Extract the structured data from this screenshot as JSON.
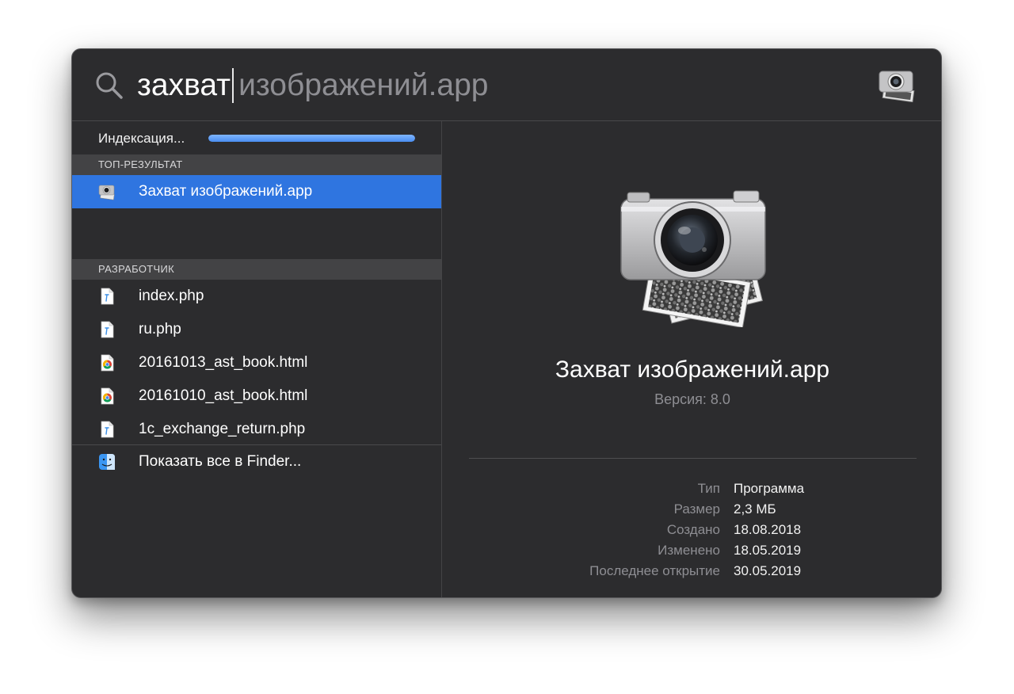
{
  "search": {
    "typed": "захват",
    "completion": "изображений.app"
  },
  "indexing": {
    "label": "Индексация...",
    "progress": 1.0
  },
  "sections": {
    "top_result": "ТОП-РЕЗУЛЬТАТ",
    "developer": "РАЗРАБОТЧИК"
  },
  "top_result": {
    "label": "Захват изображений.app",
    "icon": "image-capture-icon"
  },
  "developer_items": [
    {
      "label": "index.php",
      "icon": "php-file-icon"
    },
    {
      "label": "ru.php",
      "icon": "php-file-icon"
    },
    {
      "label": "20161013_ast_book.html",
      "icon": "chrome-html-icon"
    },
    {
      "label": "20161010_ast_book.html",
      "icon": "chrome-html-icon"
    },
    {
      "label": "1c_exchange_return.php",
      "icon": "php-file-icon"
    }
  ],
  "show_all": {
    "label": "Показать все в Finder...",
    "icon": "finder-icon"
  },
  "preview": {
    "name": "Захват изображений.app",
    "version": "Версия: 8.0",
    "meta": [
      {
        "key": "Тип",
        "value": "Программа"
      },
      {
        "key": "Размер",
        "value": "2,3 МБ"
      },
      {
        "key": "Создано",
        "value": "18.08.2018"
      },
      {
        "key": "Изменено",
        "value": "18.05.2019"
      },
      {
        "key": "Последнее открытие",
        "value": "30.05.2019"
      }
    ]
  },
  "colors": {
    "window_bg": "#2c2c2e",
    "selection": "#2f75e0",
    "section_header": "#434345",
    "progress": "#4a8ef0"
  }
}
